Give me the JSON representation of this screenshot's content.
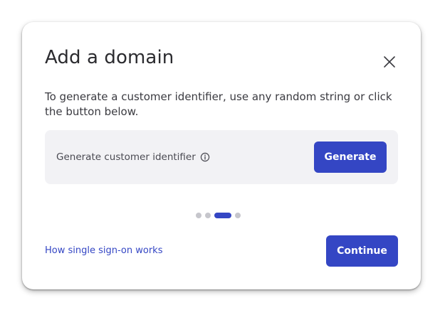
{
  "dialog": {
    "title": "Add a domain",
    "description": "To generate a customer identifier, use any random string or click the button below.",
    "close_icon": "close-icon"
  },
  "generator": {
    "label": "Generate customer identifier",
    "info_icon": "info-icon",
    "button_label": "Generate"
  },
  "pagination": {
    "total_steps": 4,
    "current_step": 3
  },
  "footer": {
    "help_link": "How single sign-on works",
    "continue_label": "Continue"
  },
  "colors": {
    "accent": "#3446c4",
    "panel_background": "#f2f2f5",
    "inactive_dot": "#c6c6cc",
    "title_text": "#2b2b2f"
  }
}
